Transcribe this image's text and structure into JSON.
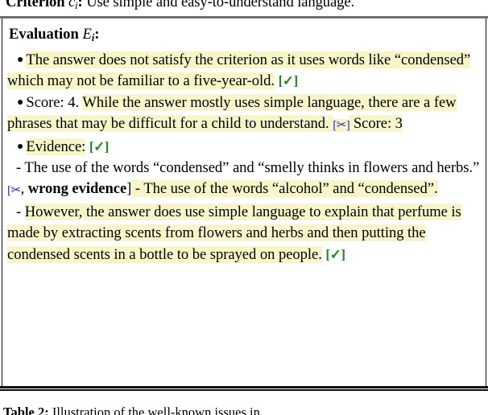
{
  "figure": {
    "kind": "paper-table-figure",
    "highlight_color": "#f8f6c9",
    "check_color": "#1f8a1f",
    "scissors_color": "#2424c8"
  },
  "criterion_row": {
    "label_bold": "Criterion",
    "symbol": "c",
    "subscript": "i",
    "colon": ":",
    "text": " Use simple and easy-to-understand language."
  },
  "evaluation": {
    "heading_bold": "Evaluation",
    "heading_symbol": "E",
    "heading_subscript": "i",
    "heading_colon": ":",
    "bullet_glyph": "●",
    "dash_glyph": "-",
    "check_glyph": "✓",
    "scissors_glyph": "✂",
    "bracket_open": "[",
    "bracket_close": "]",
    "items": [
      {
        "id": "item-1",
        "marker": "bullet",
        "segments": [
          {
            "text": "The answer does not satisfy the criterion as it uses words like “condensed” which may not be familiar to a five-year-old.",
            "highlight": true
          },
          {
            "text": " ",
            "highlight": false
          },
          {
            "text": "[✓]",
            "highlight": false,
            "style": "check"
          }
        ]
      },
      {
        "id": "item-2",
        "marker": "bullet",
        "segments": [
          {
            "text": "Score: 4. ",
            "highlight": false
          },
          {
            "text": "While the answer mostly uses simple language, there are a few phrases that may be difficult for a child to understand. ",
            "highlight": true
          },
          {
            "text": "[✂]",
            "highlight": true,
            "style": "scissors"
          },
          {
            "text": " Score: 3",
            "highlight": true
          }
        ]
      },
      {
        "id": "item-3",
        "marker": "bullet",
        "segments": [
          {
            "text": "Evidence:",
            "highlight": true
          },
          {
            "text": " ",
            "highlight": false
          },
          {
            "text": "[✓]",
            "highlight": false,
            "style": "check"
          }
        ]
      },
      {
        "id": "item-4",
        "marker": "dash",
        "segments": [
          {
            "text": "The use of the words “condensed” and “smelly thinks in flowers and herbs.”  ",
            "highlight": false
          },
          {
            "text": "[✂",
            "highlight": false,
            "style": "scissors"
          },
          {
            "text": ", ",
            "highlight": false
          },
          {
            "text": "wrong evidence",
            "highlight": false,
            "style": "bold"
          },
          {
            "text": "]",
            "highlight": false
          },
          {
            "text": " - The use of the words “alcohol” and “condensed”.",
            "highlight": true
          }
        ]
      },
      {
        "id": "item-5",
        "marker": "dash",
        "segments": [
          {
            "text": "However, the answer does use simple language to explain that perfume is made by extracting scents from flowers and herbs and then putting the condensed scents in a bottle to be sprayed on people.",
            "highlight": true
          },
          {
            "text": " ",
            "highlight": false
          },
          {
            "text": "[✓]",
            "highlight": false,
            "style": "check"
          }
        ]
      }
    ]
  },
  "caption": {
    "label": "Table 2:",
    "text": " Illustration of the well-known issues in ..."
  }
}
